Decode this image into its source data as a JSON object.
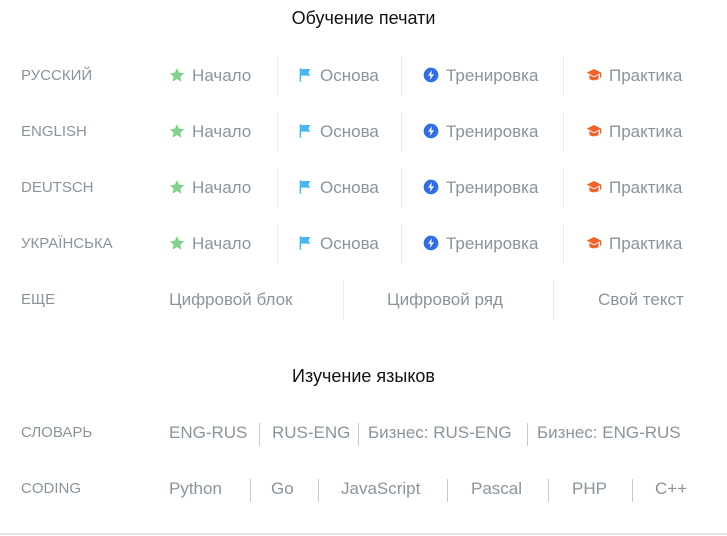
{
  "typing": {
    "title": "Обучение печати",
    "rows": [
      {
        "label": "РУССКИЙ",
        "items": [
          "Начало",
          "Основа",
          "Тренировка",
          "Практика"
        ]
      },
      {
        "label": "ENGLISH",
        "items": [
          "Начало",
          "Основа",
          "Тренировка",
          "Практика"
        ]
      },
      {
        "label": "DEUTSCH",
        "items": [
          "Начало",
          "Основа",
          "Тренировка",
          "Практика"
        ]
      },
      {
        "label": "УКРАЇНСЬКА",
        "items": [
          "Начало",
          "Основа",
          "Тренировка",
          "Практика"
        ]
      }
    ],
    "more": {
      "label": "ЕЩЕ",
      "items": [
        "Цифровой блок",
        "Цифровой ряд",
        "Свой текст"
      ]
    },
    "icons": [
      "star-icon",
      "flag-icon",
      "bolt-icon",
      "graduation-cap-icon"
    ],
    "icon_colors": [
      "#7ed58a",
      "#48b7f0",
      "#2f6ee8",
      "#f0642a"
    ]
  },
  "languages": {
    "title": "Изучение языков",
    "dictionary": {
      "label": "СЛОВАРЬ",
      "items": [
        "ENG-RUS",
        "RUS-ENG",
        "Бизнес: RUS-ENG",
        "Бизнес: ENG-RUS"
      ]
    },
    "coding": {
      "label": "CODING",
      "items": [
        "Python",
        "Go",
        "JavaScript",
        "Pascal",
        "PHP",
        "C++"
      ]
    }
  }
}
